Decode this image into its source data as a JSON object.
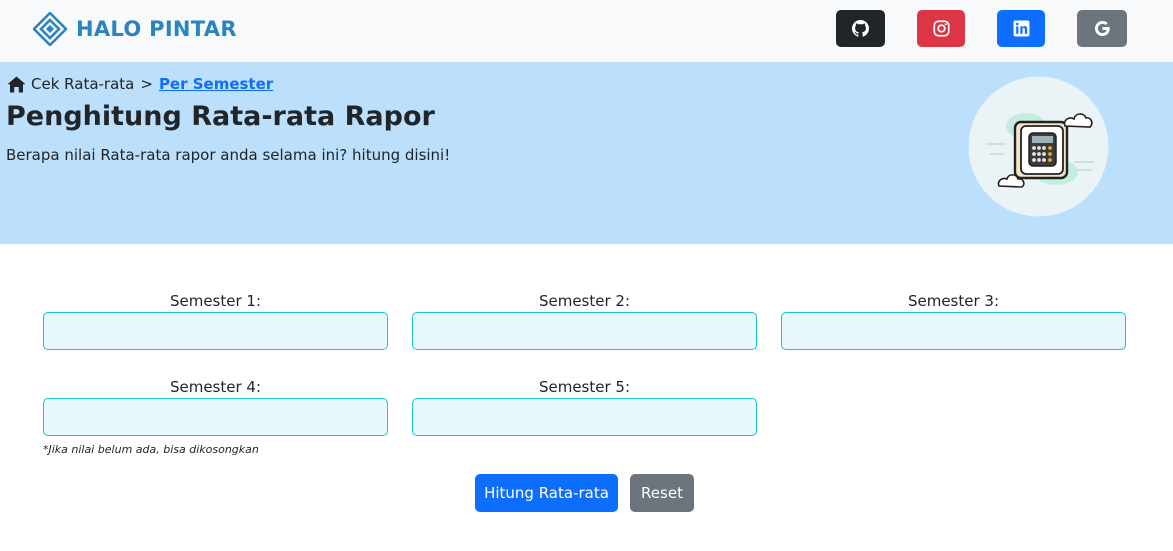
{
  "brand": {
    "name": "HALO PINTAR",
    "logo_icon": "diamond-logo-icon",
    "color": "#2b84c2"
  },
  "social": [
    {
      "name": "github",
      "icon": "github-icon",
      "color": "#212529"
    },
    {
      "name": "instagram",
      "icon": "instagram-icon",
      "color": "#dc3545"
    },
    {
      "name": "linkedin",
      "icon": "linkedin-icon",
      "color": "#0d6efd"
    },
    {
      "name": "google",
      "icon": "google-icon",
      "color": "#6c757d"
    }
  ],
  "breadcrumb": {
    "home_icon": "home-icon",
    "root": "Cek Rata-rata",
    "separator": ">",
    "current": "Per Semester"
  },
  "hero": {
    "title": "Penghitung Rata-rata Rapor",
    "subtitle": "Berapa nilai Rata-rata rapor anda selama ini? hitung disini!",
    "background": "#bcdffb",
    "illustration": "calculator-illustration"
  },
  "form": {
    "fields": [
      {
        "label": "Semester 1:",
        "value": ""
      },
      {
        "label": "Semester 2:",
        "value": ""
      },
      {
        "label": "Semester 3:",
        "value": ""
      },
      {
        "label": "Semester 4:",
        "value": ""
      },
      {
        "label": "Semester 5:",
        "value": ""
      }
    ],
    "note": "*Jika nilai belum ada, bisa dikosongkan",
    "submit_label": "Hitung Rata-rata",
    "reset_label": "Reset"
  }
}
